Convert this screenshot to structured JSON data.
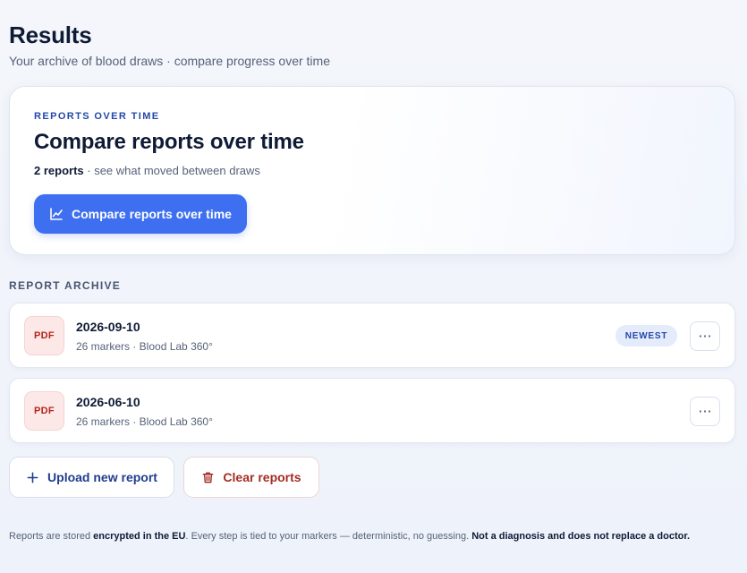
{
  "header": {
    "title": "Results",
    "subtitle": "Your archive of blood draws · compare progress over time"
  },
  "hero": {
    "eyebrow": "REPORTS OVER TIME",
    "title": "Compare reports over time",
    "count_label": "2 reports",
    "meta_rest": " · see what moved between draws",
    "button_label": "Compare reports over time",
    "button_icon": "line-chart-icon"
  },
  "archive": {
    "section_label": "REPORT ARCHIVE",
    "reports": [
      {
        "type_label": "PDF",
        "date": "2026-09-10",
        "meta": "26 markers · Blood Lab 360°",
        "badge": "NEWEST",
        "more_label": "···"
      },
      {
        "type_label": "PDF",
        "date": "2026-06-10",
        "meta": "26 markers · Blood Lab 360°",
        "badge": "",
        "more_label": "···"
      }
    ]
  },
  "actions": {
    "upload_label": "Upload new report",
    "upload_icon": "plus-icon",
    "clear_label": "Clear reports",
    "clear_icon": "trash-icon"
  },
  "footer": {
    "part1": "Reports are stored ",
    "bold1": "encrypted in the EU",
    "part2": ". Every step is tied to your markers — deterministic, no guessing. ",
    "bold2": "Not a diagnosis and does not replace a doctor."
  },
  "colors": {
    "accent": "#3d6ff0",
    "text_dark": "#0f1b35",
    "text_muted": "#56627a",
    "danger": "#a32d23",
    "pdf_bg": "#fde8e8"
  }
}
